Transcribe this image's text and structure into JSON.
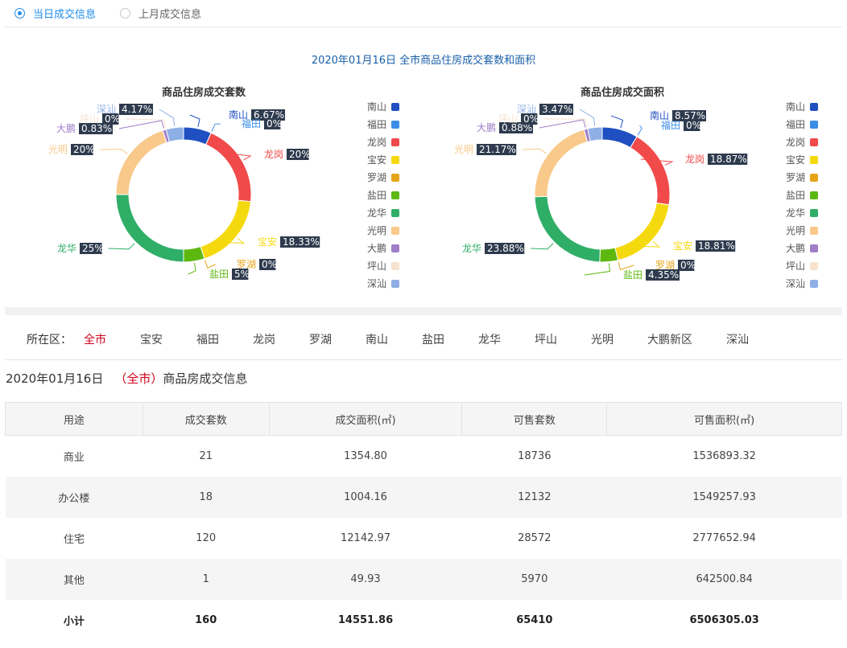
{
  "tabs": [
    {
      "label": "当日成交信息",
      "active": true
    },
    {
      "label": "上月成交信息",
      "active": false
    }
  ],
  "charts_title": "2020年01月16日 全市商品住房成交套数和面积",
  "colors": {
    "南山": "#1f4fc1",
    "福田": "#3b8ee8",
    "龙岗": "#f04a4a",
    "宝安": "#f5d90f",
    "罗湖": "#e6a417",
    "盐田": "#5cb80f",
    "龙华": "#2fae67",
    "光明": "#f8c98a",
    "大鹏": "#a07fc7",
    "坪山": "#f6e2cf",
    "深汕": "#8eaee6"
  },
  "chart_data": [
    {
      "type": "pie",
      "donut": true,
      "title": "商品住房成交套数",
      "legend_position": "right",
      "slices": [
        {
          "name": "南山",
          "value": 6.67
        },
        {
          "name": "福田",
          "value": 0
        },
        {
          "name": "龙岗",
          "value": 20
        },
        {
          "name": "宝安",
          "value": 18.33
        },
        {
          "name": "罗湖",
          "value": 0
        },
        {
          "name": "盐田",
          "value": 5
        },
        {
          "name": "龙华",
          "value": 25
        },
        {
          "name": "光明",
          "value": 20
        },
        {
          "name": "大鹏",
          "value": 0.83
        },
        {
          "name": "坪山",
          "value": 0
        },
        {
          "name": "深汕",
          "value": 4.17
        }
      ],
      "labels": [
        "6.67%",
        "0%",
        "20%",
        "18.33%",
        "0%",
        "5%",
        "25%",
        "20%",
        "0.83%",
        "0%",
        "4.17%"
      ]
    },
    {
      "type": "pie",
      "donut": true,
      "title": "商品住房成交面积",
      "legend_position": "right",
      "slices": [
        {
          "name": "南山",
          "value": 8.57
        },
        {
          "name": "福田",
          "value": 0
        },
        {
          "name": "龙岗",
          "value": 18.87
        },
        {
          "name": "宝安",
          "value": 18.81
        },
        {
          "name": "罗湖",
          "value": 0
        },
        {
          "name": "盐田",
          "value": 4.35
        },
        {
          "name": "龙华",
          "value": 23.88
        },
        {
          "name": "光明",
          "value": 21.17
        },
        {
          "name": "大鹏",
          "value": 0.88
        },
        {
          "name": "坪山",
          "value": 0
        },
        {
          "name": "深汕",
          "value": 3.47
        }
      ],
      "labels": [
        "8.57%",
        "0%",
        "18.87%",
        "18.81%",
        "0%",
        "4.35%",
        "23.88%",
        "21.17%",
        "0.88%",
        "0%",
        "3.47%"
      ]
    }
  ],
  "district_filter": {
    "label": "所在区：",
    "items": [
      "全市",
      "宝安",
      "福田",
      "龙岗",
      "罗湖",
      "南山",
      "盐田",
      "龙华",
      "坪山",
      "光明",
      "大鹏新区",
      "深汕"
    ],
    "active": "全市"
  },
  "subtitle": {
    "date": "2020年01月16日",
    "open": "（",
    "scope": "全市",
    "close": "）",
    "suffix": "商品房成交信息"
  },
  "table": {
    "headers": [
      "用途",
      "成交套数",
      "成交面积(㎡)",
      "可售套数",
      "可售面积(㎡)"
    ],
    "rows": [
      [
        "商业",
        "21",
        "1354.80",
        "18736",
        "1536893.32"
      ],
      [
        "办公楼",
        "18",
        "1004.16",
        "12132",
        "1549257.93"
      ],
      [
        "住宅",
        "120",
        "12142.97",
        "28572",
        "2777652.94"
      ],
      [
        "其他",
        "1",
        "49.93",
        "5970",
        "642500.84"
      ]
    ],
    "total": [
      "小计",
      "160",
      "14551.86",
      "65410",
      "6506305.03"
    ]
  }
}
